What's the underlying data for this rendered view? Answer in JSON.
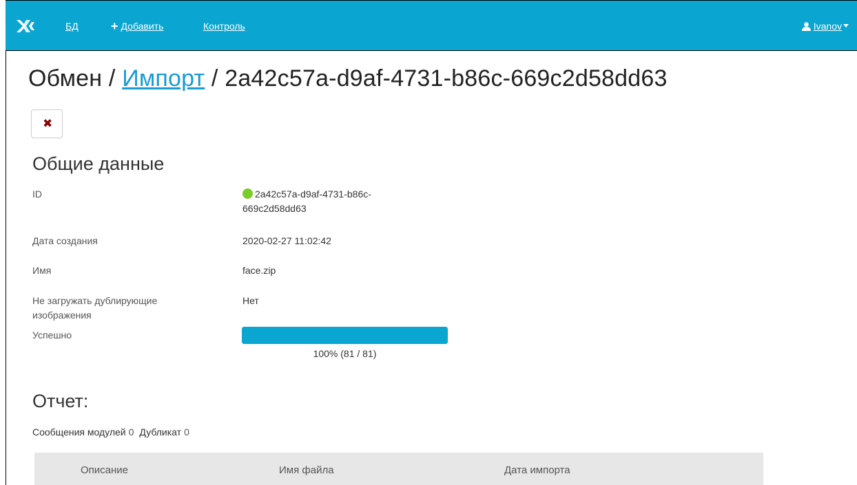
{
  "nav": {
    "logo_icon": "app-logo-icon",
    "db_label": "БД",
    "add_label": "Добавить",
    "add_icon": "plus-icon",
    "control_label": "Контроль",
    "user_icon": "user-icon",
    "user_name": "Ivanov",
    "accent_color": "#0aa5d0"
  },
  "title": {
    "prefix": "Обмен /",
    "link": "Импорт",
    "suffix": "/ 2a42c57a-d9af-4731-b86c-669c2d58dd63"
  },
  "delete_button_icon": "close-icon",
  "general": {
    "heading": "Общие данные",
    "id_label": "ID",
    "id_value_line1": "2a42c57a-d9af-4731-b86c-",
    "id_value_line2": "669c2d58dd63",
    "status_color": "#7acc29",
    "created_label": "Дата создания",
    "created_value": "2020-02-27 11:02:42",
    "name_label": "Имя",
    "name_value": "face.zip",
    "no_dupes_label": "Не загружать дублирующие изображения",
    "no_dupes_value": "Нет",
    "success_label": "Успешно",
    "progress_percent": 100,
    "progress_text": "100% (81 / 81)"
  },
  "report": {
    "heading": "Отчет:",
    "module_messages_label": "Сообщения модулей",
    "module_messages_count": "0",
    "duplicate_label": "Дубликат",
    "duplicate_count": "0",
    "columns": [
      "Описание",
      "Имя файла",
      "Дата импорта"
    ]
  }
}
